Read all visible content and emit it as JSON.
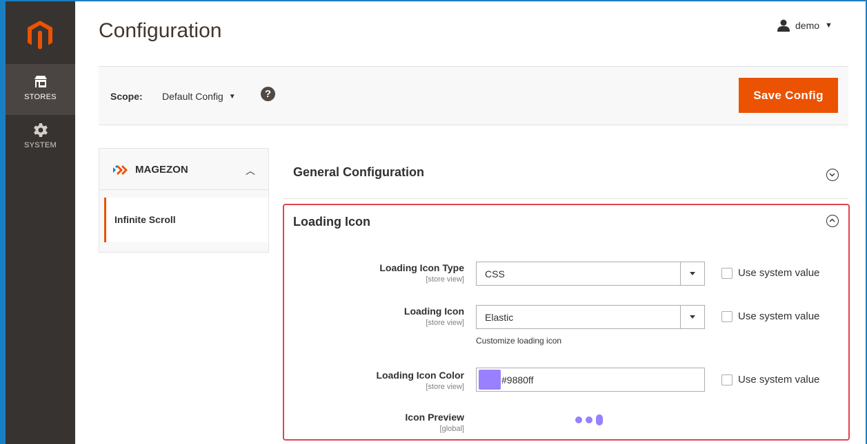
{
  "header": {
    "title": "Configuration",
    "user": "demo"
  },
  "menu": {
    "items": [
      {
        "label": "STORES"
      },
      {
        "label": "SYSTEM"
      }
    ]
  },
  "scope": {
    "label": "Scope:",
    "value": "Default Config",
    "save_label": "Save Config"
  },
  "nav": {
    "vendor": "MAGEZON",
    "item": "Infinite Scroll"
  },
  "sections": {
    "general": "General Configuration",
    "loading": "Loading Icon"
  },
  "fields": {
    "type": {
      "label": "Loading Icon Type",
      "scope": "[store view]",
      "value": "CSS",
      "use_system": "Use system value"
    },
    "icon": {
      "label": "Loading Icon",
      "scope": "[store view]",
      "value": "Elastic",
      "note": "Customize loading icon",
      "use_system": "Use system value"
    },
    "color": {
      "label": "Loading Icon Color",
      "scope": "[store view]",
      "value": "#9880ff",
      "use_system": "Use system value"
    },
    "preview": {
      "label": "Icon Preview",
      "scope": "[global]"
    }
  },
  "colors": {
    "accent": "#eb5202",
    "sidebar": "#373330",
    "highlight": "#e2434b",
    "icon_color": "#9880ff"
  }
}
